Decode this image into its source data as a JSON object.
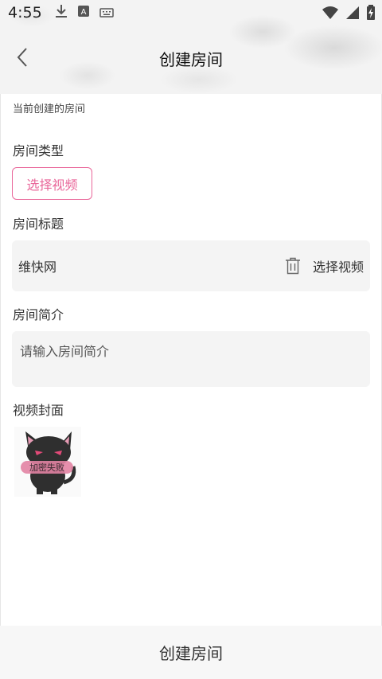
{
  "status_bar": {
    "time": "4:55",
    "icons_left": [
      "download-icon",
      "a-keyboard-icon",
      "keyboard-icon"
    ],
    "icons_right": [
      "wifi-icon",
      "signal-icon",
      "battery-charging-icon"
    ]
  },
  "header": {
    "title": "创建房间",
    "back_icon": "back-arrow-icon"
  },
  "form": {
    "subtitle": "当前创建的房间",
    "type_label": "房间类型",
    "type_button": "选择视频",
    "title_label": "房间标题",
    "title_value": "维快网",
    "title_select": "选择视频",
    "intro_label": "房间简介",
    "intro_placeholder": "请输入房间简介",
    "cover_label": "视频封面",
    "cover_text": "加密失败"
  },
  "footer": {
    "create_button": "创建房间"
  },
  "colors": {
    "accent": "#e9679a",
    "field_bg": "#f4f4f4"
  }
}
